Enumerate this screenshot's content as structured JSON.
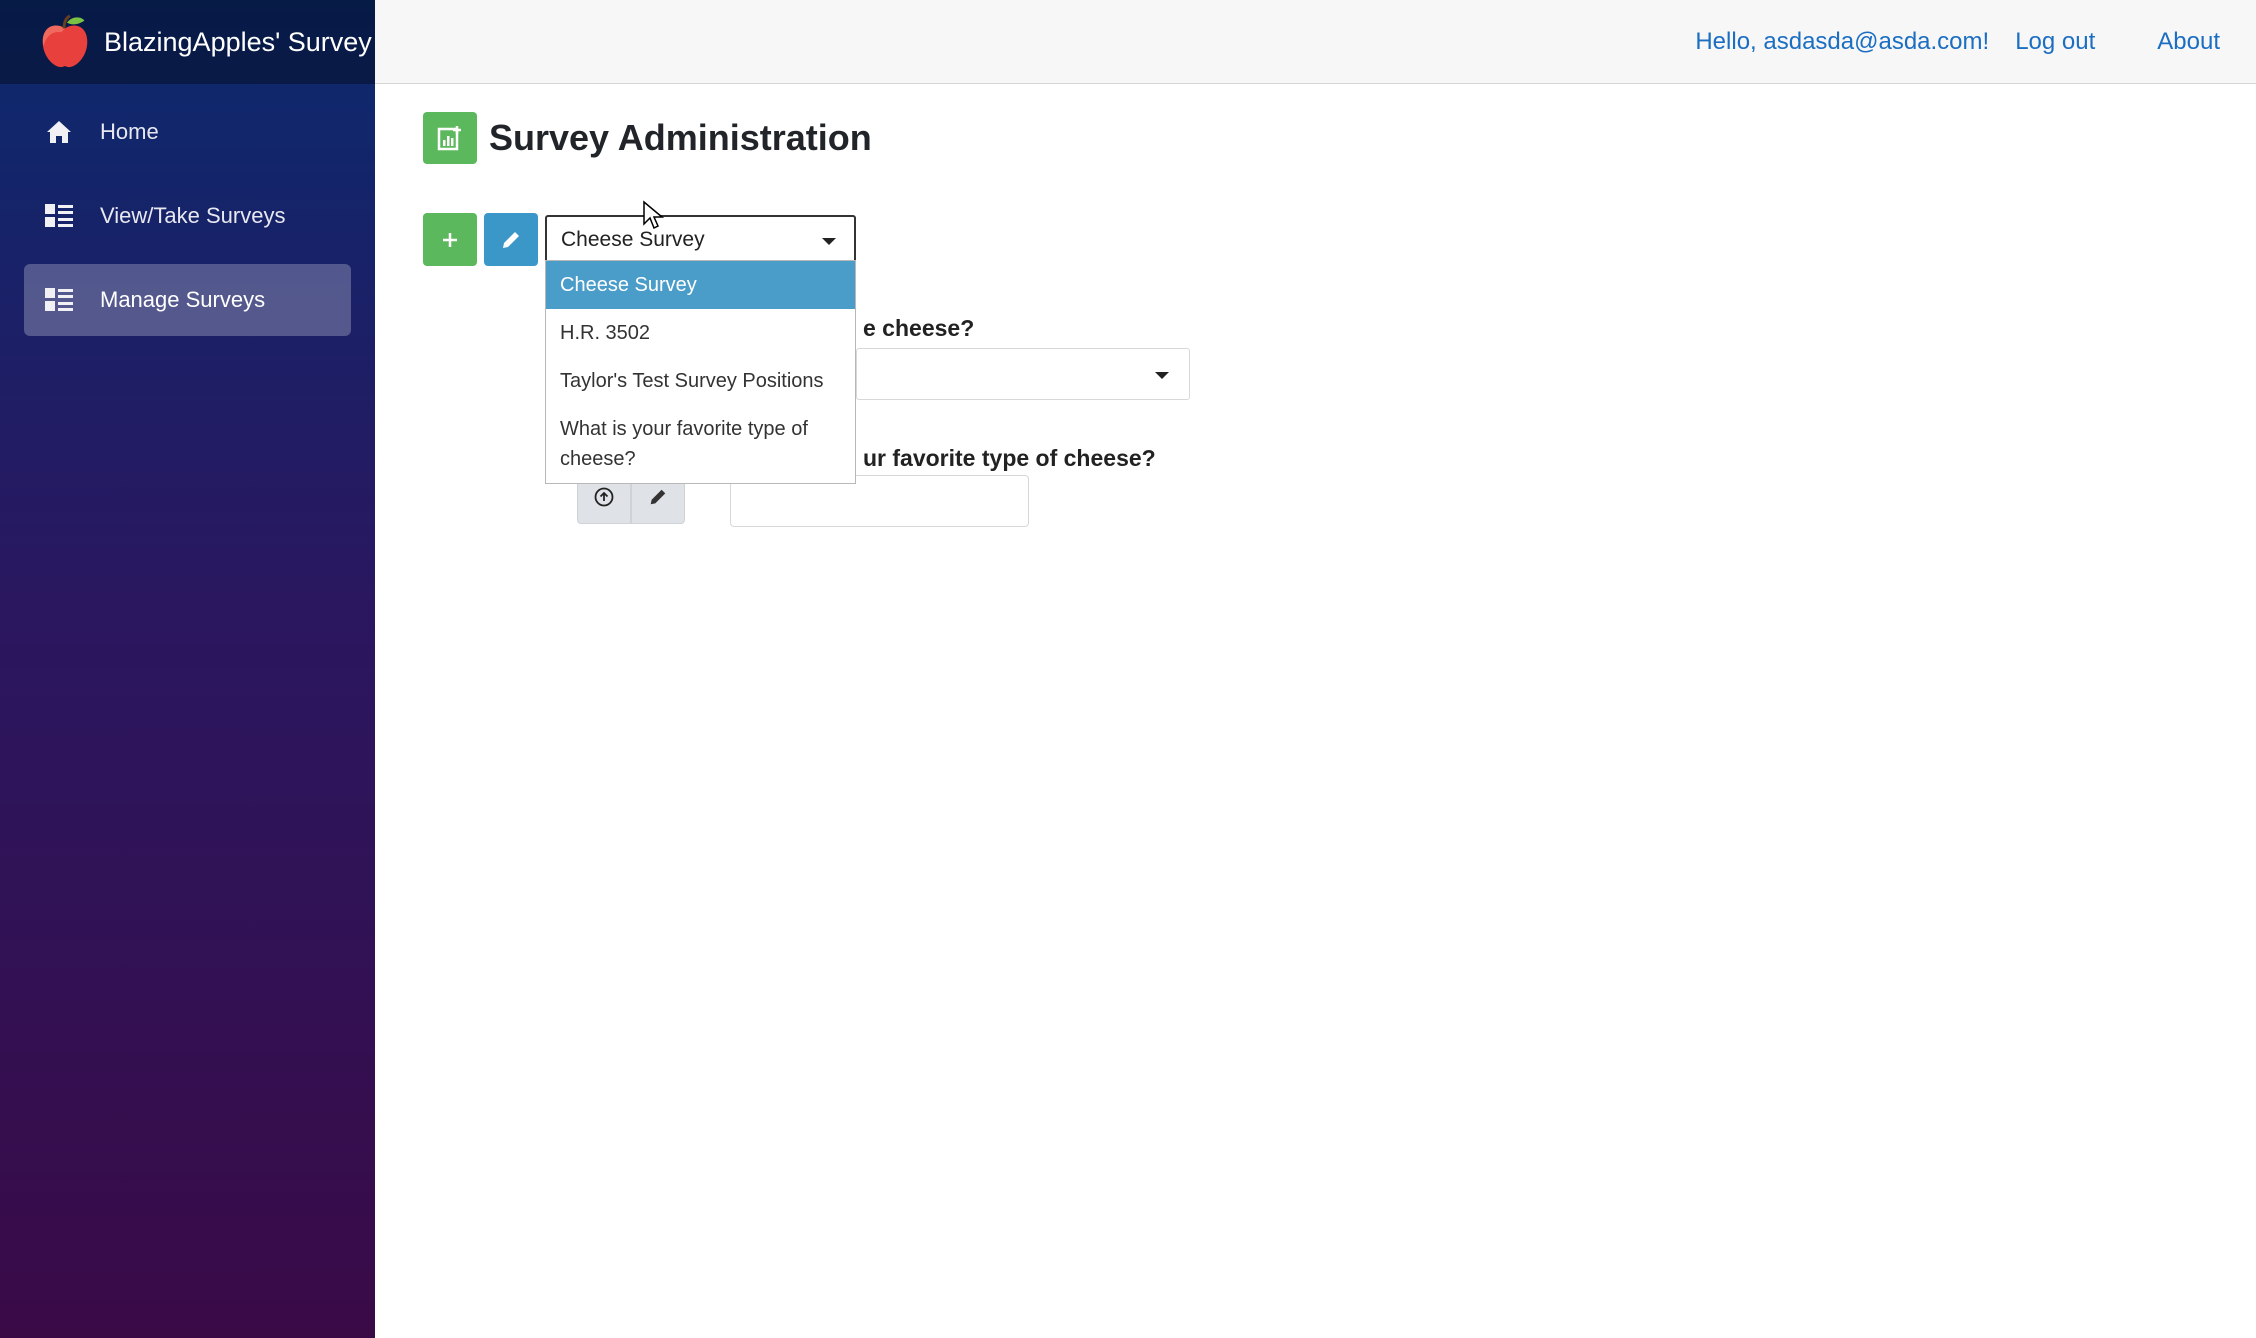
{
  "app": {
    "name": "BlazingApples' Survey"
  },
  "sidebar": {
    "items": [
      {
        "label": "Home",
        "icon": "home-icon"
      },
      {
        "label": "View/Take Surveys",
        "icon": "list-icon"
      },
      {
        "label": "Manage Surveys",
        "icon": "list-icon",
        "active": true
      }
    ]
  },
  "topbar": {
    "greeting": "Hello, asdasda@asda.com!",
    "logout": "Log out",
    "about": "About"
  },
  "page": {
    "title": "Survey Administration"
  },
  "survey_select": {
    "value": "Cheese Survey",
    "options": [
      "Cheese Survey",
      "H.R. 3502",
      "Taylor's Test Survey Positions",
      "What is your favorite type of cheese?"
    ]
  },
  "questions": {
    "q1_label_visible": "e cheese?",
    "q2_label_visible": "ur favorite type of cheese?"
  },
  "colors": {
    "accent_green": "#5cb85c",
    "accent_blue": "#3b97c8",
    "link": "#1b6ec2",
    "sidebar_top": "#0b2a6e",
    "sidebar_bottom": "#3a0a47"
  }
}
